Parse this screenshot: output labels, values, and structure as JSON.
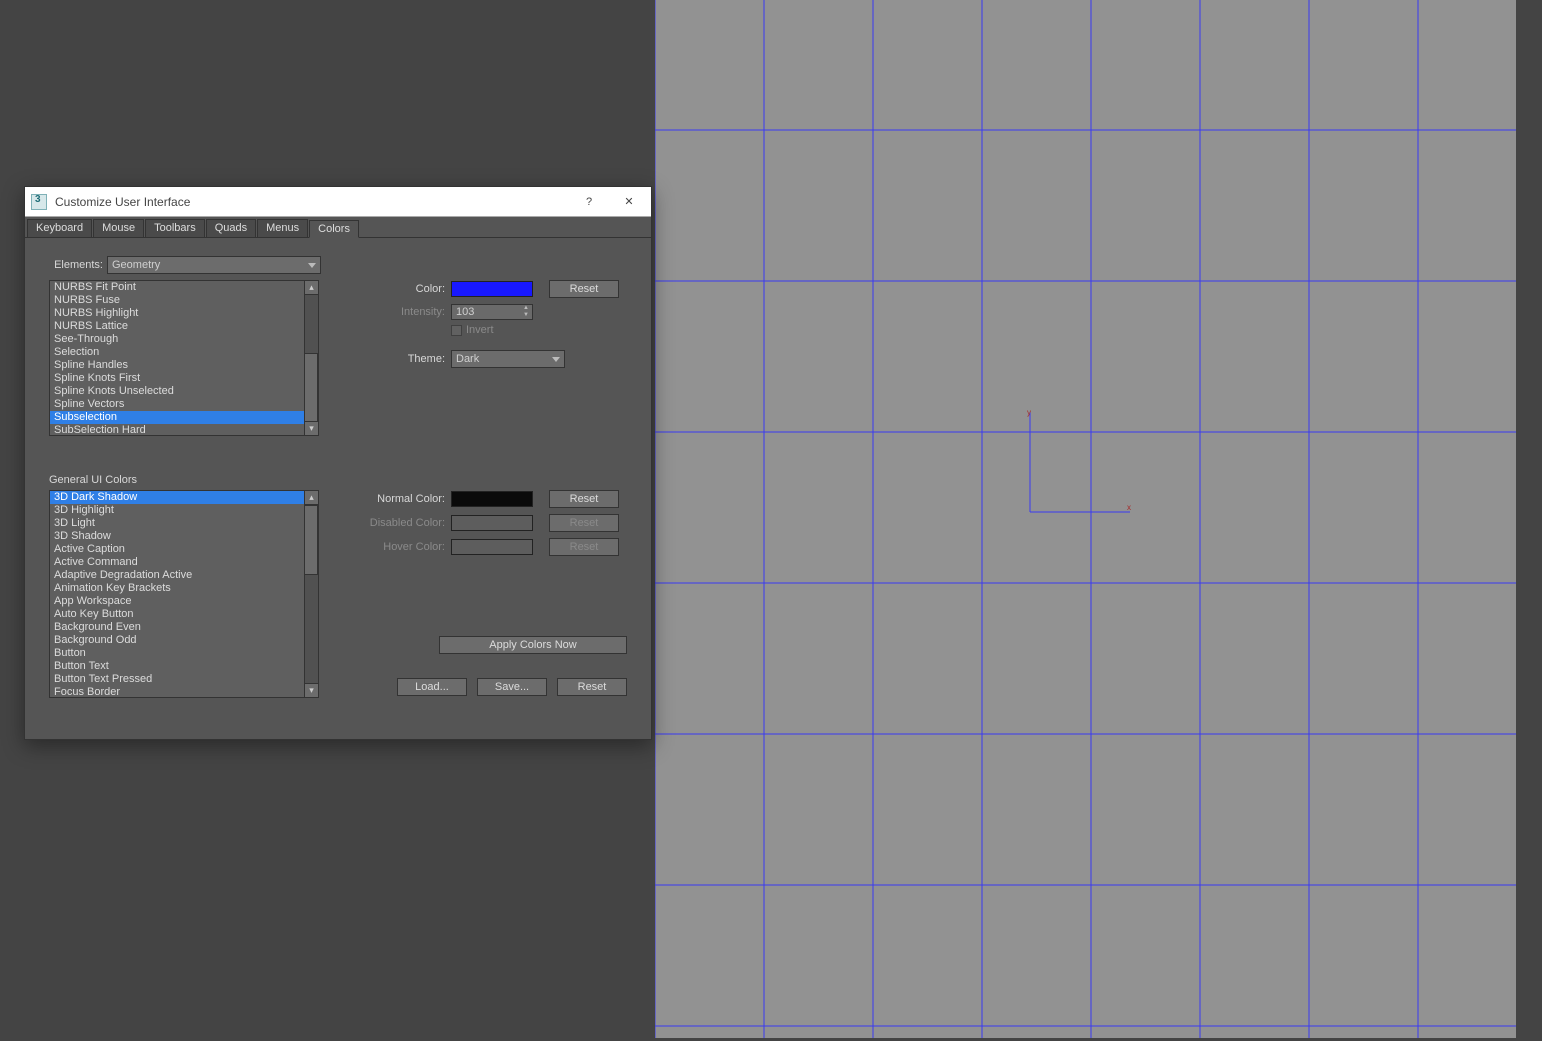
{
  "viewport": {
    "axis_label_y": "y",
    "axis_label_x": "x"
  },
  "dialog": {
    "title": "Customize User Interface",
    "help_symbol": "?",
    "close_symbol": "✕",
    "tabs": [
      "Keyboard",
      "Mouse",
      "Toolbars",
      "Quads",
      "Menus",
      "Colors"
    ],
    "active_tab_index": 5,
    "elements_label": "Elements:",
    "elements_dropdown_value": "Geometry",
    "elements_list": [
      "NURBS Fit Point",
      "NURBS Fuse",
      "NURBS Highlight",
      "NURBS Lattice",
      "See-Through",
      "Selection",
      "Spline Handles",
      "Spline Knots First",
      "Spline Knots Unselected",
      "Spline Vectors",
      "Subselection",
      "SubSelection Hard"
    ],
    "elements_selected_index": 10,
    "color_label": "Color:",
    "color_value": "#1818ff",
    "reset_label": "Reset",
    "intensity_label": "Intensity:",
    "intensity_value": "103",
    "invert_label": "Invert",
    "theme_label": "Theme:",
    "theme_value": "Dark",
    "general_header": "General UI Colors",
    "general_list": [
      "3D Dark Shadow",
      "3D Highlight",
      "3D Light",
      "3D Shadow",
      "Active Caption",
      "Active Command",
      "Adaptive Degradation Active",
      "Animation Key Brackets",
      "App Workspace",
      "Auto Key Button",
      "Background Even",
      "Background Odd",
      "Button",
      "Button Text",
      "Button Text Pressed",
      "Focus Border"
    ],
    "general_selected_index": 0,
    "normal_color_label": "Normal Color:",
    "disabled_color_label": "Disabled Color:",
    "hover_color_label": "Hover Color:",
    "apply_label": "Apply Colors Now",
    "load_label": "Load...",
    "save_label": "Save...",
    "reset_all_label": "Reset"
  }
}
